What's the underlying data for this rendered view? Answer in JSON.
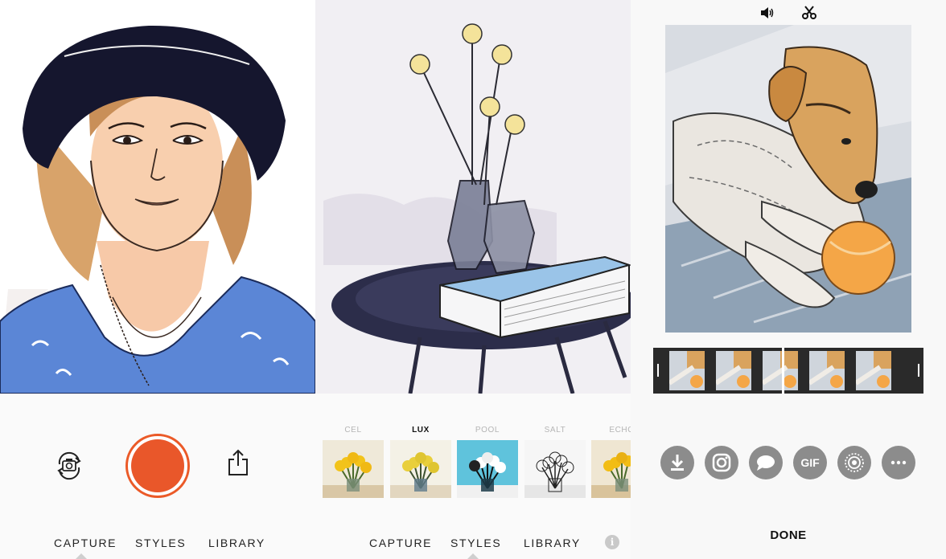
{
  "capture_screen": {
    "nav": {
      "capture": "CAPTURE",
      "styles": "STYLES",
      "library": "LIBRARY",
      "active": "capture"
    },
    "icons": {
      "flip_camera": "flip-camera-icon",
      "shutter": "shutter-button",
      "share": "share-icon"
    },
    "colors": {
      "shutter": "#e9572a"
    }
  },
  "styles_screen": {
    "filters": [
      {
        "label": "CEL",
        "active": false
      },
      {
        "label": "LUX",
        "active": true
      },
      {
        "label": "POOL",
        "active": false
      },
      {
        "label": "SALT",
        "active": false
      },
      {
        "label": "ECHO",
        "active": false
      }
    ],
    "nav": {
      "capture": "CAPTURE",
      "styles": "STYLES",
      "library": "LIBRARY",
      "active": "styles"
    },
    "info": "i"
  },
  "share_screen": {
    "top_icons": [
      "speaker-icon",
      "scissors-icon"
    ],
    "share_buttons": [
      {
        "name": "download-icon",
        "label": ""
      },
      {
        "name": "instagram-icon",
        "label": ""
      },
      {
        "name": "message-icon",
        "label": ""
      },
      {
        "name": "gif-button",
        "label": "GIF"
      },
      {
        "name": "live-photo-icon",
        "label": ""
      },
      {
        "name": "more-icon",
        "label": ""
      }
    ],
    "done": "DONE"
  }
}
